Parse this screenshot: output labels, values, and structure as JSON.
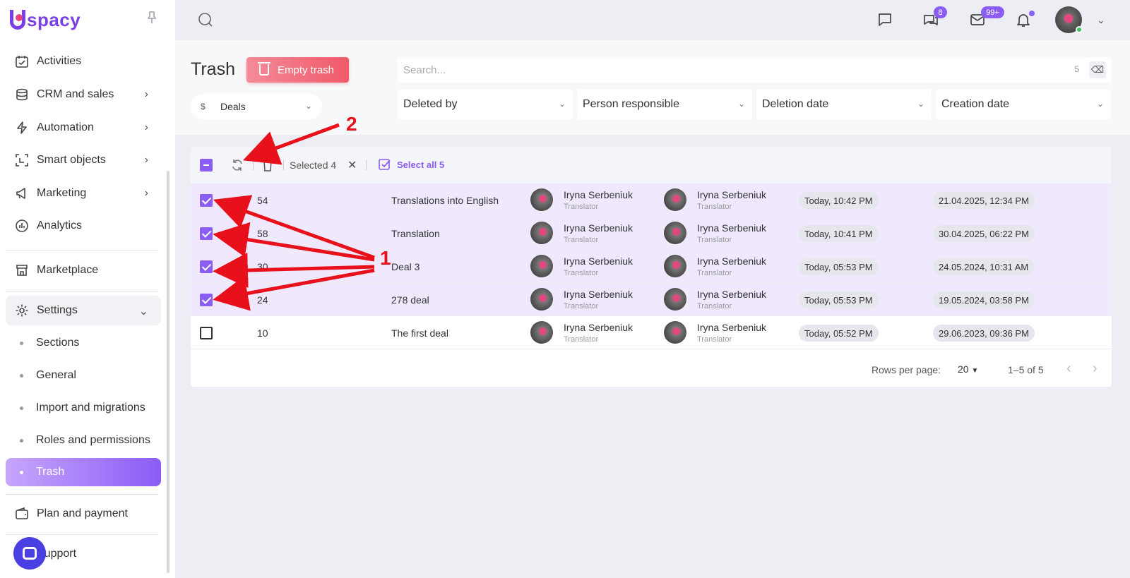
{
  "app": {
    "logo_text": "spacy"
  },
  "sidebar": {
    "items": [
      {
        "label": "Activities"
      },
      {
        "label": "CRM and sales"
      },
      {
        "label": "Automation"
      },
      {
        "label": "Smart objects"
      },
      {
        "label": "Marketing"
      },
      {
        "label": "Analytics"
      },
      {
        "label": "Marketplace"
      },
      {
        "label": "Settings"
      },
      {
        "label": "Plan and payment"
      },
      {
        "label": "Support"
      }
    ],
    "settings_sub": [
      {
        "label": "Sections"
      },
      {
        "label": "General"
      },
      {
        "label": "Import and migrations"
      },
      {
        "label": "Roles and permissions"
      },
      {
        "label": "Trash"
      }
    ]
  },
  "topbar": {
    "chats_badge": "8",
    "mail_badge": "99+"
  },
  "page": {
    "title": "Trash",
    "empty_trash_label": "Empty trash",
    "entity_select": "Deals",
    "search_placeholder": "Search...",
    "search_count": "5",
    "filters": [
      "Deleted by",
      "Person responsible",
      "Deletion date",
      "Creation date"
    ]
  },
  "toolbar": {
    "selected_text": "Selected 4",
    "select_all_label": "Select all 5"
  },
  "table": {
    "rows": [
      {
        "checked": true,
        "id": "54",
        "name": "Translations into English",
        "deleted_by": "Iryna Serbeniuk",
        "deleted_by_role": "Translator",
        "responsible": "Iryna Serbeniuk",
        "responsible_role": "Translator",
        "deletion_date": "Today, 10:42 PM",
        "creation_date": "21.04.2025, 12:34 PM"
      },
      {
        "checked": true,
        "id": "58",
        "name": "Translation",
        "deleted_by": "Iryna Serbeniuk",
        "deleted_by_role": "Translator",
        "responsible": "Iryna Serbeniuk",
        "responsible_role": "Translator",
        "deletion_date": "Today, 10:41 PM",
        "creation_date": "30.04.2025, 06:22 PM"
      },
      {
        "checked": true,
        "id": "30",
        "name": "Deal 3",
        "deleted_by": "Iryna Serbeniuk",
        "deleted_by_role": "Translator",
        "responsible": "Iryna Serbeniuk",
        "responsible_role": "Translator",
        "deletion_date": "Today, 05:53 PM",
        "creation_date": "24.05.2024, 10:31 AM"
      },
      {
        "checked": true,
        "id": "24",
        "name": "278 deal",
        "deleted_by": "Iryna Serbeniuk",
        "deleted_by_role": "Translator",
        "responsible": "Iryna Serbeniuk",
        "responsible_role": "Translator",
        "deletion_date": "Today, 05:53 PM",
        "creation_date": "19.05.2024, 03:58 PM"
      },
      {
        "checked": false,
        "id": "10",
        "name": "The first deal",
        "deleted_by": "Iryna Serbeniuk",
        "deleted_by_role": "Translator",
        "responsible": "Iryna Serbeniuk",
        "responsible_role": "Translator",
        "deletion_date": "Today, 05:52 PM",
        "creation_date": "29.06.2023, 09:36 PM"
      }
    ]
  },
  "pagination": {
    "rows_per_page_label": "Rows per page:",
    "rows_per_page_value": "20",
    "range": "1–5 of 5"
  },
  "annotations": {
    "label_1": "1",
    "label_2": "2",
    "color": "#e8101a"
  }
}
